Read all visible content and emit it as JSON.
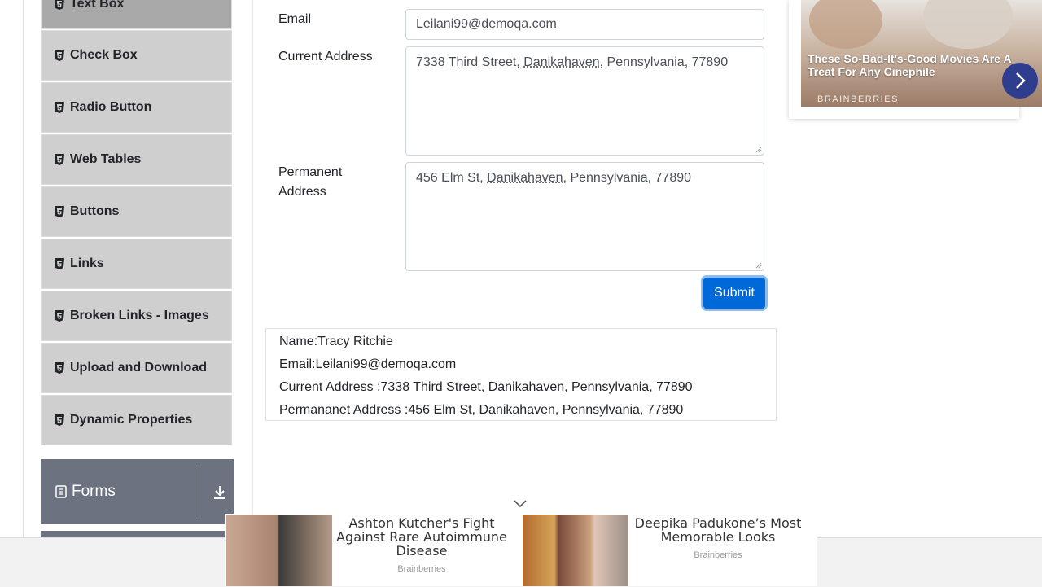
{
  "sidebar": {
    "items": [
      {
        "label": "Text Box"
      },
      {
        "label": "Check Box"
      },
      {
        "label": "Radio Button"
      },
      {
        "label": "Web Tables"
      },
      {
        "label": "Buttons"
      },
      {
        "label": "Links"
      },
      {
        "label": "Broken Links - Images"
      },
      {
        "label": "Upload and Download"
      },
      {
        "label": "Dynamic Properties"
      }
    ],
    "group": {
      "label": "Forms",
      "icon": "form-icon",
      "action_icon": "download-icon"
    }
  },
  "form": {
    "email_label": "Email",
    "email_value": "Leilani99@demoqa.com",
    "current_label": "Current Address",
    "current_before": "7338 Third Street, ",
    "current_city": "Danikahaven",
    "current_after": ", Pennsylvania, 77890",
    "permanent_label_line1": "Permanent",
    "permanent_label_line2": "Address",
    "permanent_before": "456 Elm St, ",
    "permanent_city": "Danikahaven",
    "permanent_after": ", Pennsylvania, 77890",
    "submit_label": "Submit"
  },
  "output": {
    "name": "Name:Tracy Ritchie",
    "email": "Email:Leilani99@demoqa.com",
    "current": "Current Address :7338 Third Street, Danikahaven, Pennsylvania, 77890",
    "permanent": "Permananet Address :456 Elm St, Danikahaven, Pennsylvania, 77890"
  },
  "ads": {
    "top": {
      "title": "These So-Bad-It's-Good Movies Are A Treat For Any Cinephile",
      "brand": "BRAINBERRIES"
    },
    "bottom": [
      {
        "title": "Ashton Kutcher's Fight Against Rare Autoimmune Disease",
        "source": "Brainberries"
      },
      {
        "title": "Deepika Padukone’s Most Memorable Looks",
        "source": "Brainberries"
      }
    ]
  },
  "colors": {
    "sidebar_item": "#cfcfcf",
    "group_header": "#6c7280",
    "primary": "#0069d9",
    "ad_arrow": "#2f3d8f"
  }
}
